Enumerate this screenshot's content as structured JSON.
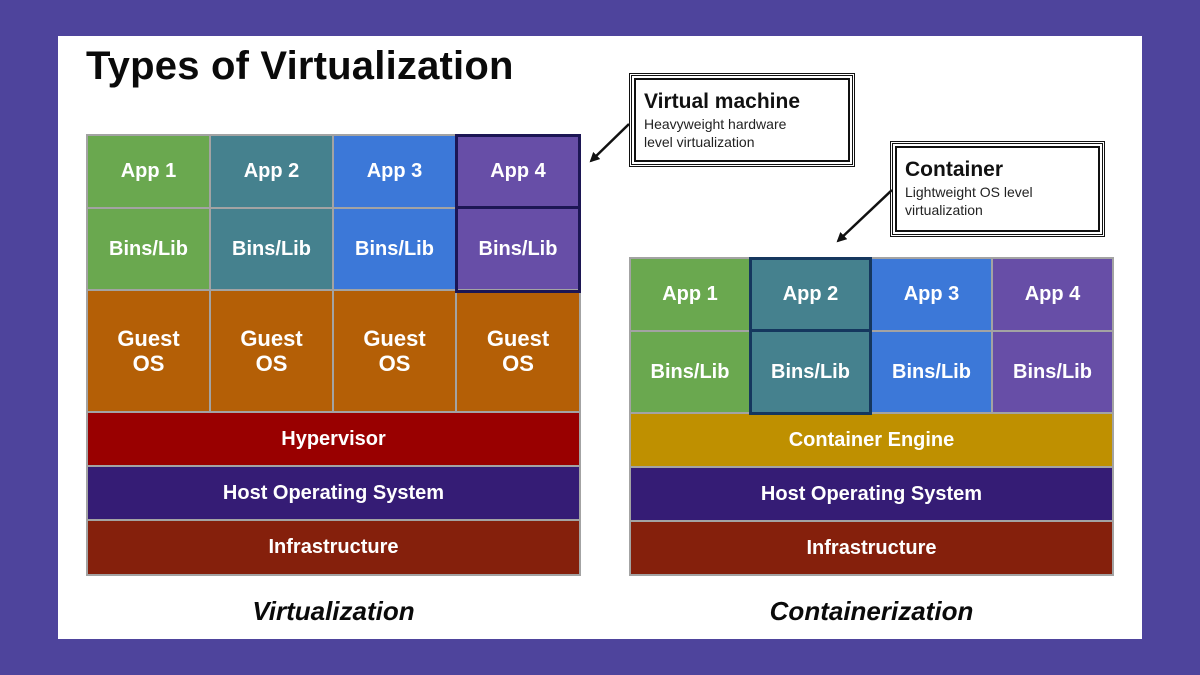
{
  "title": "Types of Virtualization",
  "colors": {
    "background": "#4e449c",
    "card": "#ffffff",
    "app1": "#6aa84f",
    "app2": "#45818e",
    "app3": "#3c78d8",
    "app4": "#674ea7",
    "guest_os": "#b45f06",
    "hypervisor": "#990000",
    "container_engine": "#bf9000",
    "host_os": "#351c75",
    "infrastructure": "#85200c",
    "highlight_vm": "#1c1654",
    "highlight_container": "#15375e"
  },
  "virtualization": {
    "caption": "Virtualization",
    "apps": [
      {
        "label": "App 1",
        "bins": "Bins/Lib",
        "guest": "Guest OS"
      },
      {
        "label": "App 2",
        "bins": "Bins/Lib",
        "guest": "Guest OS"
      },
      {
        "label": "App 3",
        "bins": "Bins/Lib",
        "guest": "Guest OS"
      },
      {
        "label": "App 4",
        "bins": "Bins/Lib",
        "guest": "Guest OS"
      }
    ],
    "layers": [
      "Hypervisor",
      "Host Operating System",
      "Infrastructure"
    ],
    "highlighted_app": "App 4"
  },
  "containerization": {
    "caption": "Containerization",
    "apps": [
      {
        "label": "App 1",
        "bins": "Bins/Lib"
      },
      {
        "label": "App 2",
        "bins": "Bins/Lib"
      },
      {
        "label": "App 3",
        "bins": "Bins/Lib"
      },
      {
        "label": "App 4",
        "bins": "Bins/Lib"
      }
    ],
    "layers": [
      "Container Engine",
      "Host Operating System",
      "Infrastructure"
    ],
    "highlighted_app": "App 2"
  },
  "callouts": {
    "vm": {
      "title": "Virtual machine",
      "line1": "Heavyweight hardware",
      "line2": "level virtualization"
    },
    "container": {
      "title": "Container",
      "line1": "Lightweight OS level",
      "line2": "virtualization"
    }
  }
}
